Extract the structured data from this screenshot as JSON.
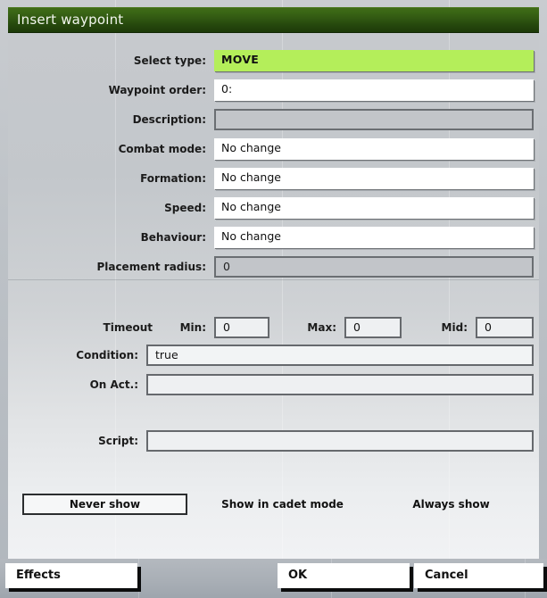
{
  "window": {
    "title": "Insert waypoint"
  },
  "form": {
    "rows": [
      {
        "label": "Select type:",
        "value": "MOVE",
        "state": "highlight"
      },
      {
        "label": "Waypoint order:",
        "value": "0:",
        "state": "editable"
      },
      {
        "label": "Description:",
        "value": "",
        "state": "disabled"
      },
      {
        "label": "Combat mode:",
        "value": "No change",
        "state": "editable"
      },
      {
        "label": "Formation:",
        "value": "No change",
        "state": "editable"
      },
      {
        "label": "Speed:",
        "value": "No change",
        "state": "editable"
      },
      {
        "label": "Behaviour:",
        "value": "No change",
        "state": "editable"
      },
      {
        "label": "Placement radius:",
        "value": "0",
        "state": "disabled"
      }
    ],
    "timeout": {
      "label": "Timeout",
      "min": {
        "label": "Min:",
        "value": "0"
      },
      "max": {
        "label": "Max:",
        "value": "0"
      },
      "mid": {
        "label": "Mid:",
        "value": "0"
      }
    },
    "condition": {
      "label": "Condition:",
      "value": "true"
    },
    "on_act": {
      "label": "On Act.:",
      "value": ""
    },
    "script": {
      "label": "Script:",
      "value": ""
    }
  },
  "visibility": {
    "options": [
      {
        "label": "Never show",
        "selected": true
      },
      {
        "label": "Show in cadet mode",
        "selected": false
      },
      {
        "label": "Always show",
        "selected": false
      }
    ]
  },
  "footer": {
    "effects_label": "Effects",
    "ok_label": "OK",
    "cancel_label": "Cancel"
  },
  "colors": {
    "titlebar_green": "#2f5511",
    "highlight_green": "#b4ee5a",
    "panel_grey": "#c6c9cd",
    "bottom_bar_grey": "#a9afb6"
  }
}
